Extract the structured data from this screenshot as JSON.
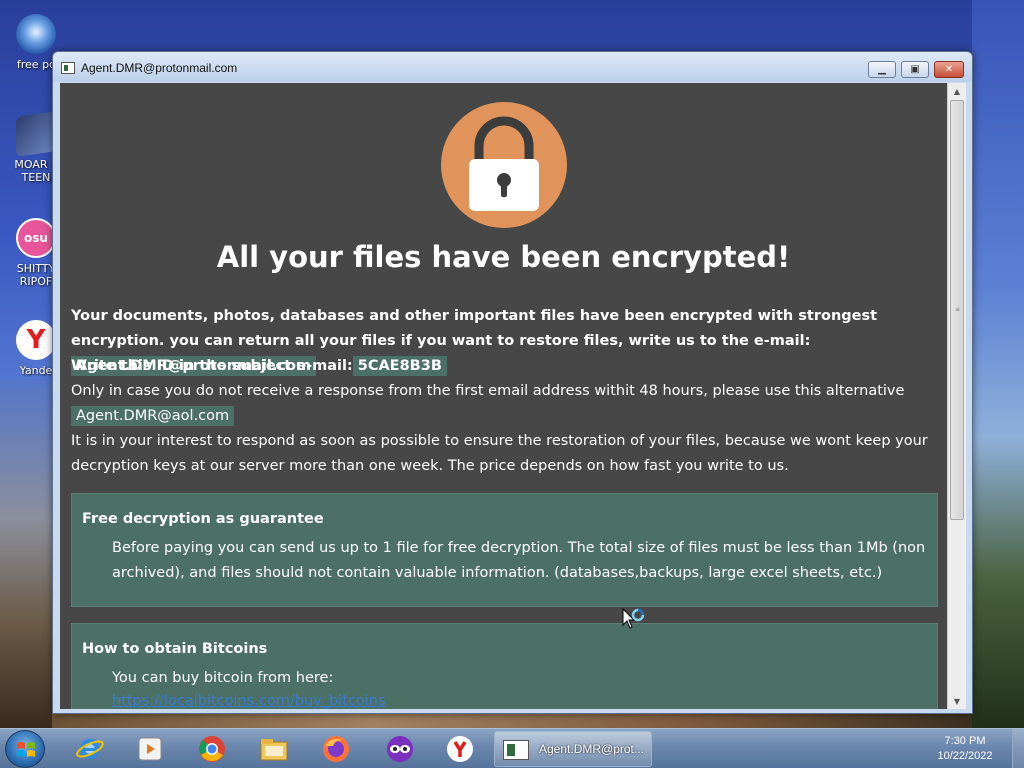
{
  "desktop": {
    "icons": [
      {
        "label": "free pc"
      },
      {
        "label": "MOAR P"
      },
      {
        "label": "TEEN"
      },
      {
        "label": "SHITTY"
      },
      {
        "label": "RIPOF"
      },
      {
        "label": "Yande"
      }
    ],
    "osu_text": "osu"
  },
  "window": {
    "title": "Agent.DMR@protonmail.com",
    "buttons": {
      "minimize": "▁",
      "maximize": "▣",
      "close": "✕"
    }
  },
  "content": {
    "headline": "All your files have been encrypted!",
    "p1_text": "Your documents, photos, databases and other important files have been encrypted with strongest encryption. you can return all your files if you want to restore files, write us to the e-mail:",
    "primary_email": "Agent.DMR@protonmail.com",
    "p2_text": "Write this ID in the subject e-mail:",
    "id": "5CAE8B3B",
    "p3_text": "Only in case you do not receive a response from the first email address withit 48 hours, please use this alternative email adress:",
    "alt_email": "Agent.DMR@aol.com",
    "p4_text": "It is in your interest to respond as soon as possible to ensure the restoration of your files, because we wont keep your decryption keys at our server more than one week. The price depends on how fast you write to us.",
    "box1": {
      "title": "Free decryption as guarantee",
      "body": "Before paying you can send us up to 1 file for free decryption. The total size of files must be less than 1Mb (non archived), and files should not contain valuable information. (databases,backups, large excel sheets, etc.)"
    },
    "box2": {
      "title": "How to obtain Bitcoins",
      "body": "You can buy bitcoin from here:",
      "link": "https://localbitcoins.com/buy_bitcoins"
    }
  },
  "taskbar": {
    "pinned": [
      "ie-icon",
      "media-player-icon",
      "chrome-icon",
      "explorer-icon",
      "firefox-icon",
      "mask-app-icon",
      "yandex-icon"
    ],
    "active_task_label": "Agent.DMR@prot...",
    "time": "7:30 PM",
    "date": "10/22/2022"
  },
  "colors": {
    "panel_bg": "#474747",
    "accent_green": "#4c7065",
    "lock_orange": "#e0935a"
  }
}
